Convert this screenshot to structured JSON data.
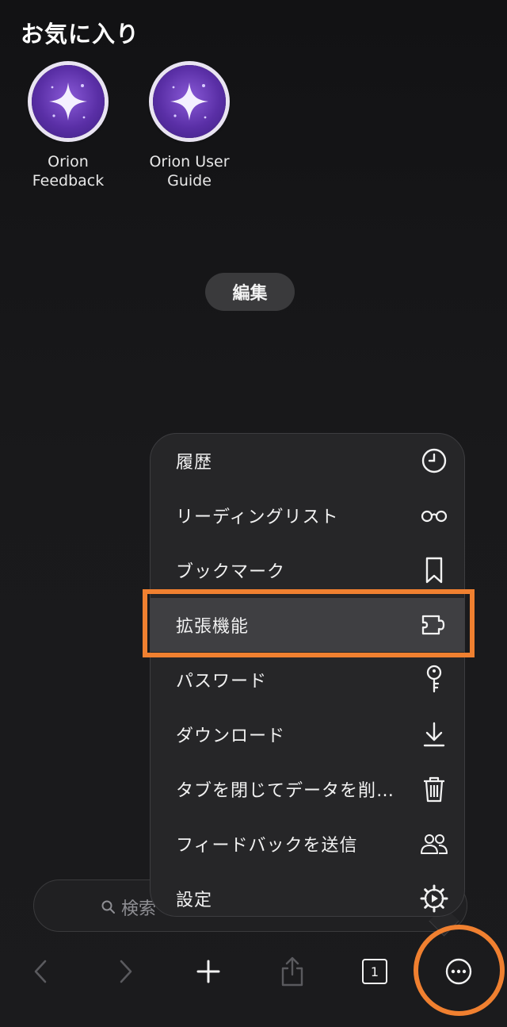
{
  "favorites": {
    "title": "お気に入り",
    "items": [
      {
        "label": "Orion\nFeedback",
        "icon": "orion-sparkle-icon"
      },
      {
        "label": "Orion User\nGuide",
        "icon": "orion-sparkle-icon"
      }
    ],
    "edit_label": "編集"
  },
  "search": {
    "placeholder": "検索"
  },
  "menu": {
    "items": [
      {
        "label": "履歴",
        "icon": "clock-icon"
      },
      {
        "label": "リーディングリスト",
        "icon": "glasses-icon"
      },
      {
        "label": "ブックマーク",
        "icon": "bookmark-icon"
      },
      {
        "label": "拡張機能",
        "icon": "puzzle-icon",
        "highlighted": true
      },
      {
        "label": "パスワード",
        "icon": "key-icon"
      },
      {
        "label": "ダウンロード",
        "icon": "download-icon"
      },
      {
        "label": "タブを閉じてデータを削…",
        "icon": "trash-icon"
      },
      {
        "label": "フィードバックを送信",
        "icon": "people-icon"
      },
      {
        "label": "設定",
        "icon": "gear-icon"
      }
    ]
  },
  "toolbar": {
    "tab_count": "1",
    "buttons": [
      "back-icon",
      "forward-icon",
      "plus-icon",
      "share-icon",
      "tabs-icon",
      "more-icon"
    ]
  },
  "colors": {
    "accent_annotation": "#f08030",
    "menu_bg": "#262628",
    "highlight_bg": "#3f3f42"
  }
}
